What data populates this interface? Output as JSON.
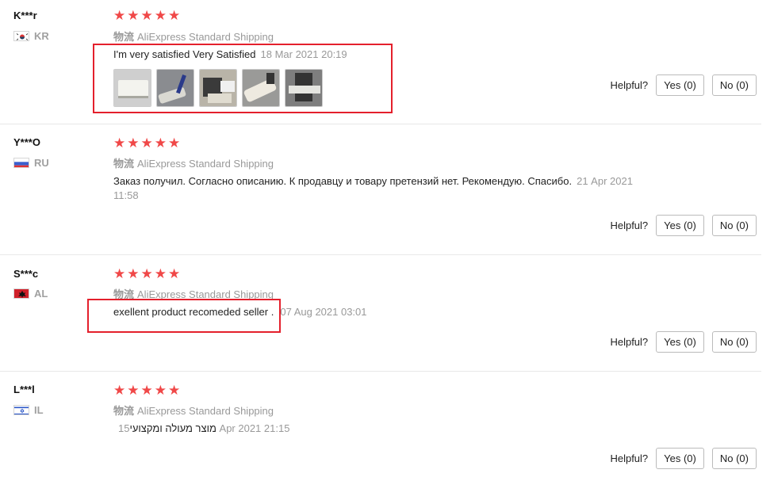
{
  "reviews": [
    {
      "user": "K***r",
      "country": "KR",
      "stars": [
        "★",
        "★",
        "★",
        "★",
        "★"
      ],
      "logistics_label": "物流",
      "shipping": "AliExpress Standard Shipping",
      "text": "I'm very satisfied Very Satisfied",
      "date": "18 Mar 2021 20:19",
      "photos": [
        "router-photo",
        "crimp-tool-photo",
        "connector-photo",
        "tester-photo",
        "cable-photo"
      ],
      "helpful_label": "Helpful?",
      "yes_label": "Yes (0)",
      "no_label": "No (0)"
    },
    {
      "user": "Y***O",
      "country": "RU",
      "stars": [
        "★",
        "★",
        "★",
        "★",
        "★"
      ],
      "logistics_label": "物流",
      "shipping": "AliExpress Standard Shipping",
      "text": "Заказ получил. Согласно описанию. К продавцу и товару претензий нет. Рекомендую. Спасибо.",
      "date": "21 Apr 2021",
      "date_line2": "11:58",
      "helpful_label": "Helpful?",
      "yes_label": "Yes (0)",
      "no_label": "No (0)"
    },
    {
      "user": "S***c",
      "country": "AL",
      "stars": [
        "★",
        "★",
        "★",
        "★",
        "★"
      ],
      "logistics_label": "物流",
      "shipping": "AliExpress Standard Shipping",
      "text": "exellent product recomeded seller .",
      "date": "07 Aug 2021 03:01",
      "helpful_label": "Helpful?",
      "yes_label": "Yes (0)",
      "no_label": "No (0)"
    },
    {
      "user": "L***l",
      "country": "IL",
      "stars": [
        "★",
        "★",
        "★",
        "★",
        "★"
      ],
      "logistics_label": "物流",
      "shipping": "AliExpress Standard Shipping",
      "text": "מוצר מעולה ומקצועי",
      "date": "15 Apr 2021 21:15",
      "helpful_label": "Helpful?",
      "yes_label": "Yes (0)",
      "no_label": "No (0)"
    }
  ],
  "colors": {
    "star": "#f04848",
    "highlight": "#e4202c",
    "muted_text": "#999999"
  }
}
